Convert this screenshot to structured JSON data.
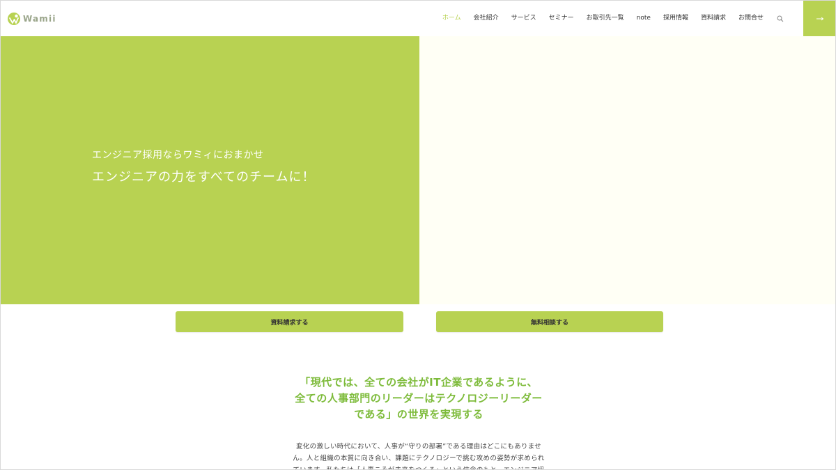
{
  "header": {
    "logo_text": "Wamii",
    "nav": [
      {
        "label": "ホーム",
        "active": true
      },
      {
        "label": "会社紹介",
        "active": false
      },
      {
        "label": "サービス",
        "active": false
      },
      {
        "label": "セミナー",
        "active": false
      },
      {
        "label": "お取引先一覧",
        "active": false
      },
      {
        "label": "note",
        "active": false
      },
      {
        "label": "採用情報",
        "active": false
      },
      {
        "label": "資料請求",
        "active": false
      },
      {
        "label": "お問合せ",
        "active": false
      }
    ],
    "search_icon": "search-icon",
    "menu_icon": "arrow-right-icon"
  },
  "hero": {
    "subtitle": "エンジニア採用ならワミィにおまかせ",
    "title": "エンジニアの力をすべてのチームに！"
  },
  "cta": {
    "document_request": "資料請求する",
    "free_consultation": "無料相談する"
  },
  "mission": {
    "lines": [
      "「現代では、全ての会社がIT企業であるように、",
      "全ての人事部門のリーダーはテクノロジーリーダー",
      "である」の世界を実現する"
    ]
  },
  "body": {
    "lines": [
      "変化の激しい時代において、人事が“守りの部署”である理由はどこにもありませ",
      "ん。人と組織の本質に向き合い、課題にテクノロジーで挑む攻めの姿勢が求められ",
      "ています。私たちは「人事こそが未来をつくる」という信念のもと、エンジニア採"
    ]
  },
  "colors": {
    "brand_green": "#b8d252",
    "mission_green": "#7dbb3a",
    "hero_right_bg": "#fffff5"
  }
}
